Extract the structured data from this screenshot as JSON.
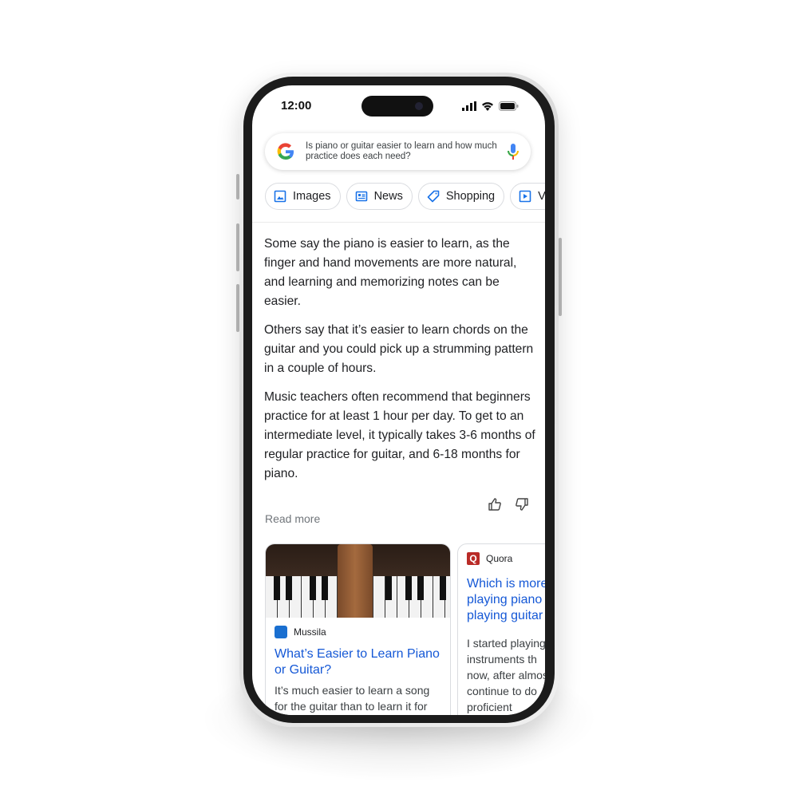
{
  "status_bar": {
    "time": "12:00"
  },
  "search": {
    "query": "Is piano or guitar easier to learn and how much practice does each need?"
  },
  "chips": [
    {
      "label": "Images",
      "icon": "image-icon"
    },
    {
      "label": "News",
      "icon": "news-icon"
    },
    {
      "label": "Shopping",
      "icon": "tag-icon"
    },
    {
      "label": "Videos",
      "icon": "play-icon"
    }
  ],
  "answer": {
    "paragraphs": [
      "Some say the piano is easier to learn, as the finger and hand movements are more natural, and learning and memorizing notes can be easier.",
      "Others say that it’s easier to learn chords on the guitar and you could pick up a strumming pattern in a couple of hours.",
      "Music teachers often recommend that beginners practice for at least 1 hour per day. To get to an intermediate level, it typically takes 3-6 months of regular practice for guitar, and 6-18 months for piano."
    ],
    "read_more": "Read more"
  },
  "cards": [
    {
      "source": "Mussila",
      "title": "What’s Easier to Learn Piano or Guitar?",
      "snippet": "It’s much easier to learn a song for the guitar than to learn it for"
    },
    {
      "source": "Quora",
      "title": "Which is more playing piano playing guitar",
      "snippet": "I started playing instruments th now, after almost continue to do proficient"
    }
  ],
  "colors": {
    "link": "#1558d6",
    "quora": "#b92b27",
    "mussila": "#1a6fd0"
  }
}
